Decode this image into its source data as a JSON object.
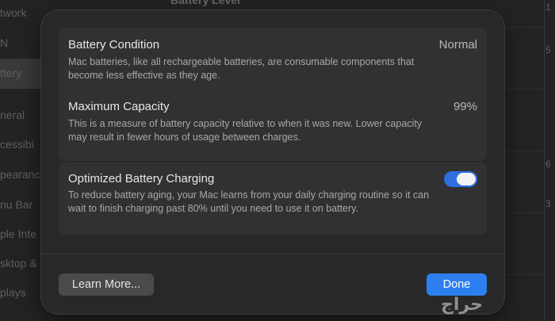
{
  "background": {
    "title": "Battery Level",
    "sidebar_items": [
      "twork",
      "N",
      "ttery",
      "neral",
      "cessibi",
      "pearanc",
      "nu Bar",
      "ple Inte",
      "sktop &",
      "plays"
    ],
    "axis_labels": [
      "1",
      "5",
      "",
      "",
      "6",
      "3",
      ""
    ]
  },
  "dialog": {
    "battery_condition": {
      "title": "Battery Condition",
      "value": "Normal",
      "description": "Mac batteries, like all rechargeable batteries, are consumable components that become less effective as they age."
    },
    "maximum_capacity": {
      "title": "Maximum Capacity",
      "value": "99%",
      "description": "This is a measure of battery capacity relative to when it was new. Lower capacity may result in fewer hours of usage between charges."
    },
    "optimized_charging": {
      "title": "Optimized Battery Charging",
      "enabled": true,
      "description": "To reduce battery aging, your Mac learns from your daily charging routine so it can wait to finish charging past 80% until you need to use it on battery."
    },
    "buttons": {
      "learn_more": "Learn More...",
      "done": "Done"
    }
  },
  "watermark": "حراج",
  "colors": {
    "accent": "#2d7ff0",
    "toggle_on": "#2e6fdf"
  }
}
